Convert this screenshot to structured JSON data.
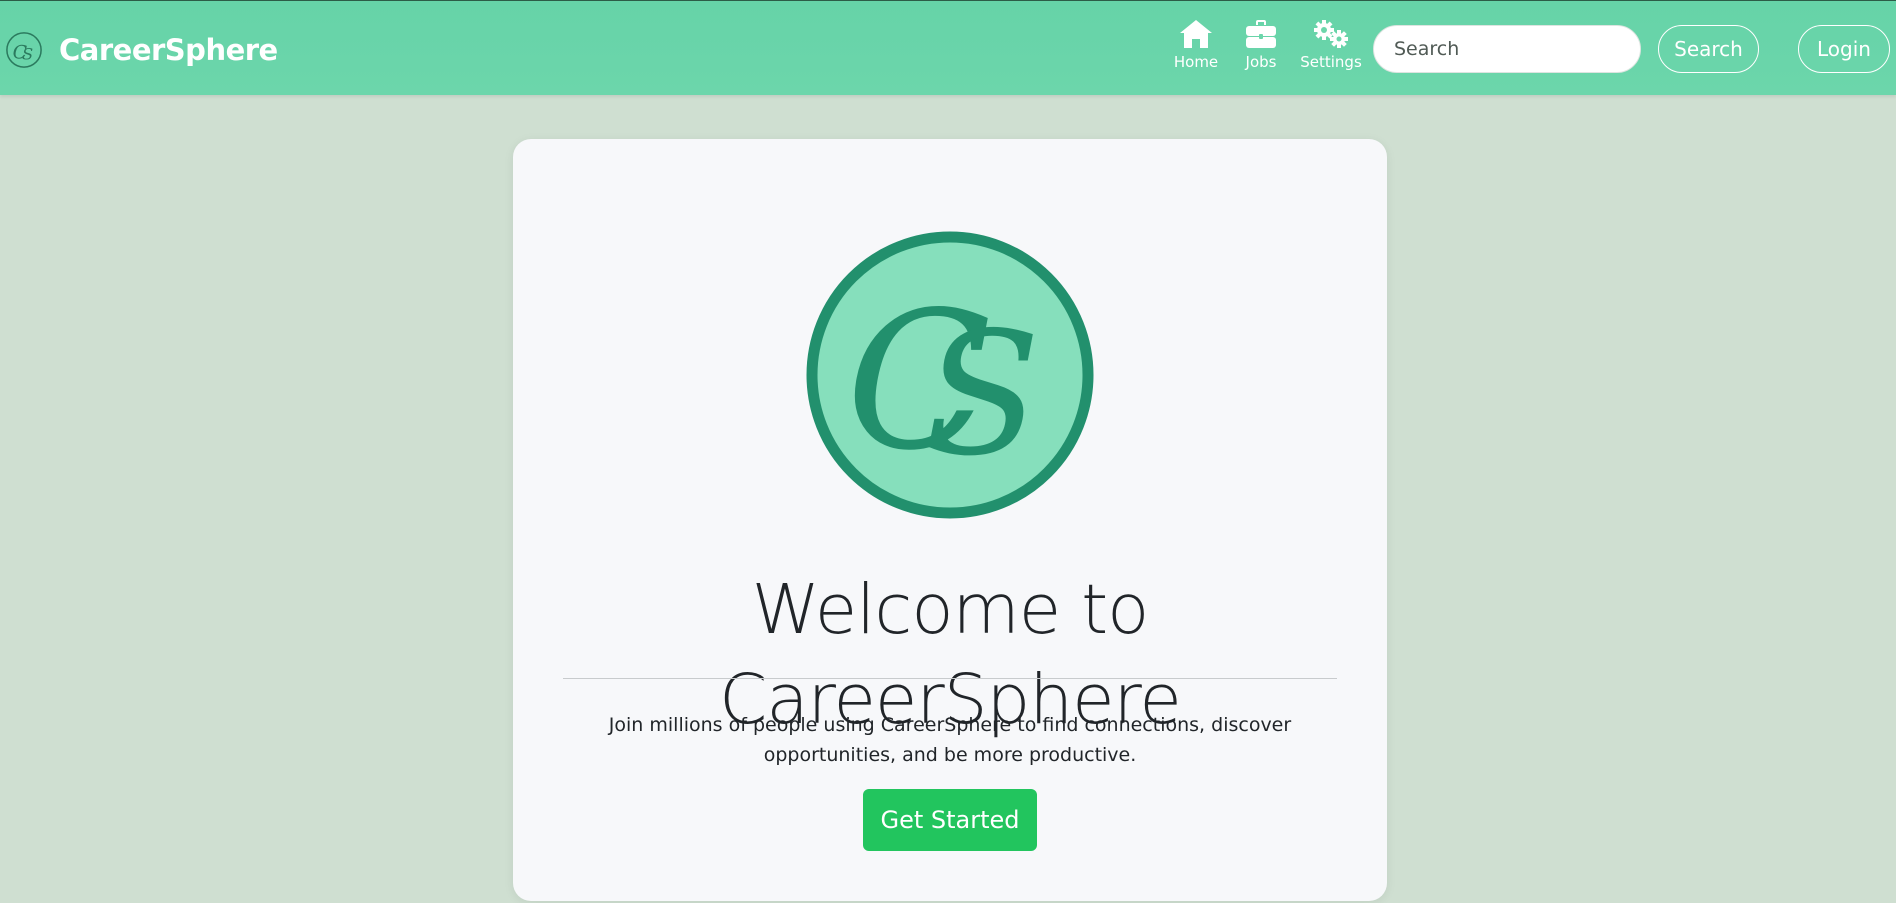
{
  "brand": {
    "name": "CareerSphere",
    "logo_icon": "cs-monogram-icon"
  },
  "nav": {
    "home_label": "Home",
    "jobs_label": "Jobs",
    "settings_label": "Settings"
  },
  "search": {
    "placeholder": "Search",
    "value": "",
    "button_label": "Search"
  },
  "login_label": "Login",
  "hero": {
    "title": "Welcome to CareerSphere",
    "lead": "Join millions of people using CareerSphere to find connections, discover opportunities, and be more productive.",
    "cta_label": "Get Started"
  },
  "colors": {
    "navbar": "#66d3a8",
    "background": "#cfdfd1",
    "card": "#f7f8fa",
    "logo_ring": "#22906d",
    "logo_fill": "#86dfbc",
    "cta": "#22c55e"
  }
}
